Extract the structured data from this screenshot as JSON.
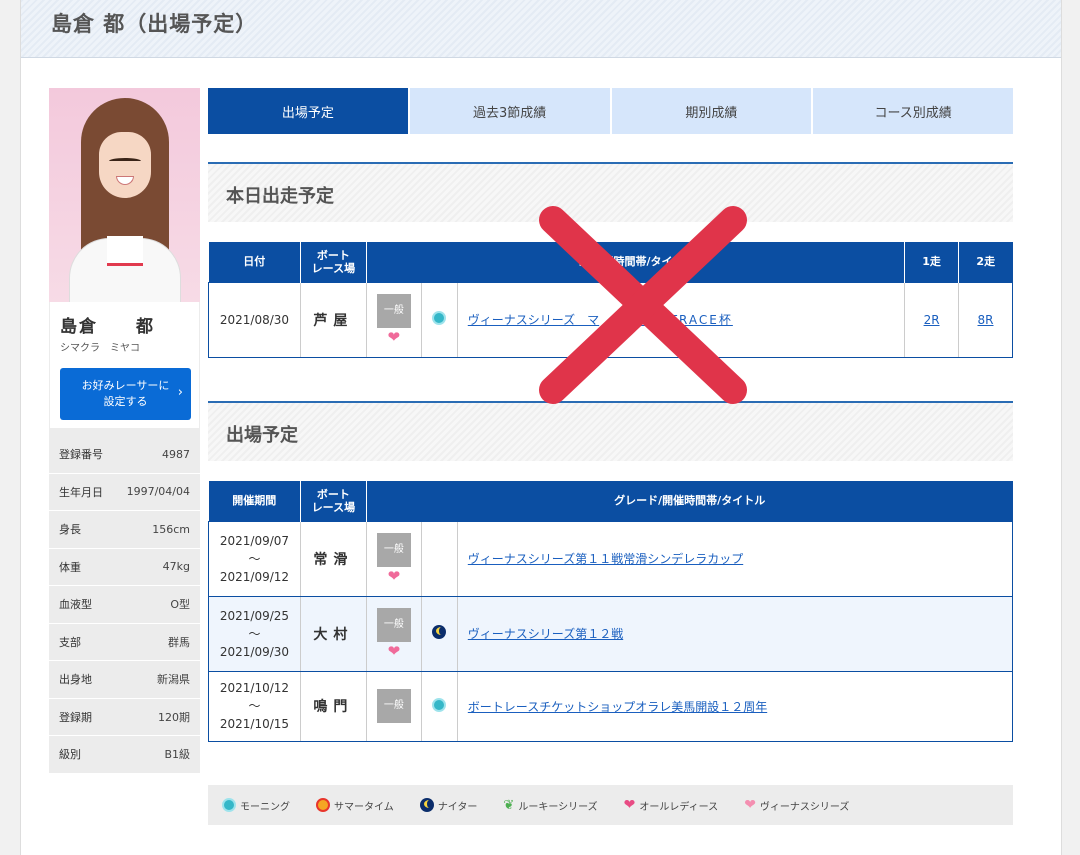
{
  "page": {
    "title": "島倉 都（出場予定）"
  },
  "racer": {
    "name": "島倉　　都",
    "kana": "シマクラ　ミヤコ",
    "favorite_button": [
      "お好みレーサーに",
      "設定する"
    ],
    "info": [
      {
        "label": "登録番号",
        "value": "4987"
      },
      {
        "label": "生年月日",
        "value": "1997/04/04"
      },
      {
        "label": "身長",
        "value": "156cm"
      },
      {
        "label": "体重",
        "value": "47kg"
      },
      {
        "label": "血液型",
        "value": "O型"
      },
      {
        "label": "支部",
        "value": "群馬"
      },
      {
        "label": "出身地",
        "value": "新潟県"
      },
      {
        "label": "登録期",
        "value": "120期"
      },
      {
        "label": "級別",
        "value": "B1級"
      }
    ]
  },
  "tabs": [
    "出場予定",
    "過去3節成績",
    "期別成績",
    "コース別成績"
  ],
  "today": {
    "section_title": "本日出走予定",
    "headers": {
      "date": "日付",
      "venue_1": "ボート",
      "venue_2": "レース場",
      "grade": "グレード/開催時間帯/タイトル",
      "race1": "1走",
      "race2": "2走"
    },
    "grade_header_visible": "ド/開催時間帯/タイトル",
    "row": {
      "date": "2021/08/30",
      "venue": "芦屋",
      "grade": "一般",
      "title_left": "ヴィーナスシリーズ　マ",
      "title_right": "BOATRACE杯",
      "race1": "2R",
      "race2": "8R"
    }
  },
  "schedule": {
    "section_title": "出場予定",
    "headers": {
      "period": "開催期間",
      "venue_1": "ボート",
      "venue_2": "レース場",
      "grade": "グレード/開催時間帯/タイトル"
    },
    "rows": [
      {
        "start": "2021/09/07",
        "sep": "～",
        "end": "2021/09/12",
        "venue": "常滑",
        "grade": "一般",
        "heart": true,
        "time_icon": "",
        "title": "ヴィーナスシリーズ第１１戦常滑シンデレラカップ"
      },
      {
        "start": "2021/09/25",
        "sep": "～",
        "end": "2021/09/30",
        "venue": "大村",
        "grade": "一般",
        "heart": true,
        "time_icon": "night",
        "title": "ヴィーナスシリーズ第１２戦"
      },
      {
        "start": "2021/10/12",
        "sep": "～",
        "end": "2021/10/15",
        "venue": "鳴門",
        "grade": "一般",
        "heart": false,
        "time_icon": "morning",
        "title": "ボートレースチケットショップオラレ美馬開設１２周年"
      }
    ]
  },
  "legend": [
    {
      "icon": "morning",
      "label": "モーニング"
    },
    {
      "icon": "summer",
      "label": "サマータイム"
    },
    {
      "icon": "night",
      "label": "ナイター"
    },
    {
      "icon": "rookie",
      "label": "ルーキーシリーズ"
    },
    {
      "icon": "all-ladies",
      "label": "オールレディース"
    },
    {
      "icon": "venus",
      "label": "ヴィーナスシリーズ"
    }
  ],
  "colors": {
    "primary": "#0b4ea2",
    "tab_inactive": "#d6e6fb",
    "button": "#0a6bd6",
    "xmark": "#e0344a",
    "heart": "#f06a9a"
  }
}
